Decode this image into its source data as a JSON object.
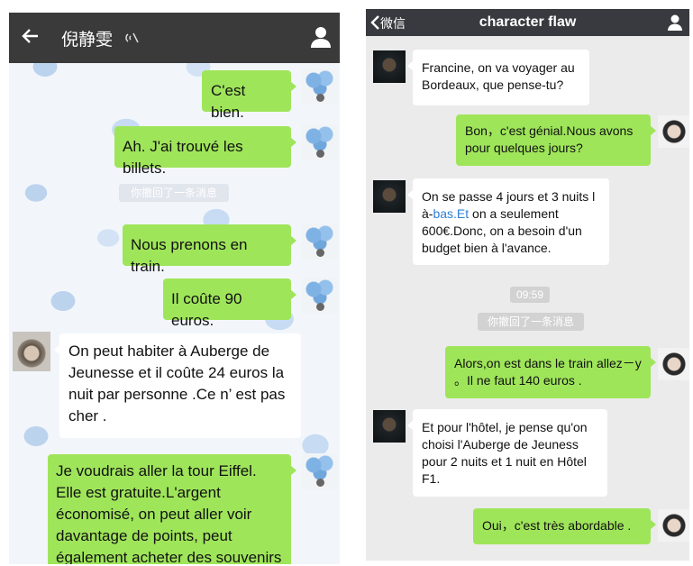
{
  "left": {
    "header": {
      "title": "倪静雯",
      "mute_icon": "mute-icon",
      "back_icon": "back-arrow-icon",
      "profile_icon": "user-icon"
    },
    "messages": [
      {
        "text": "C'est bien."
      },
      {
        "text": "Ah. J'ai trouvé les billets."
      },
      {
        "text": "你撤回了一条消息"
      },
      {
        "text": "Nous prenons en train."
      },
      {
        "text": "Il coûte 90 euros."
      },
      {
        "text": "On peut habiter à Auberge de Jeunesse et il coûte 24 euros la nuit par personne .Ce n’ est pas cher ."
      },
      {
        "text": "Je voudrais aller la tour Eiffel. Elle est gratuite.L'argent économisé, on peut aller voir davantage de points, peut également acheter des souvenirs"
      }
    ]
  },
  "right": {
    "header": {
      "back_label": "微信",
      "title": "character flaw",
      "profile_icon": "user-icon"
    },
    "messages": [
      {
        "text": "Francine, on va voyager au Bordeaux, que pense-tu?"
      },
      {
        "text": "Bon，c'est génial.Nous avons pour quelques jours?"
      },
      {
        "text_before": "On se passe 4 jours et 3 nuits l à-",
        "link": "bas.Et",
        "text_after": " on a seulement 600€.Donc, on a besoin d'un budget bien à l'avance."
      },
      {
        "text": "09:59"
      },
      {
        "text": "你撤回了一条消息"
      },
      {
        "text": "Alors,on est dans le train allez－y 。Il ne faut 140 euros ."
      },
      {
        "text": "Et pour l'hôtel, je pense qu'on choisi l'Auberge de Jeuness pour 2 nuits et 1 nuit en Hôtel F1."
      },
      {
        "text": "Oui，c'est très abordable ."
      }
    ]
  },
  "colors": {
    "green_bubble": "#9fe55a",
    "dark_bar": "#3a3a3a",
    "link": "#2f7fd6"
  }
}
